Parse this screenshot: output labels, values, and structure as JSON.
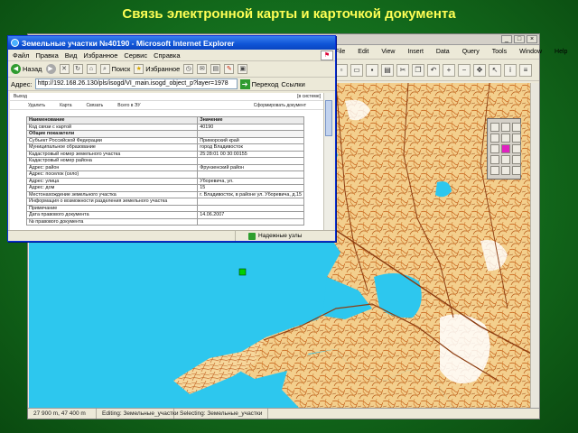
{
  "slide": {
    "title": "Связь электронной карты и карточкой документа"
  },
  "gis": {
    "menu": [
      "File",
      "Edit",
      "View",
      "Insert",
      "Data",
      "Query",
      "Tools",
      "Window",
      "Help"
    ],
    "status": {
      "coords": "27 900 m, 47 400 m",
      "editing": "Editing: Земельные_участки",
      "selecting": "Selecting: Земельные_участки"
    }
  },
  "ie": {
    "title": "Земельные участки №40190 - Microsoft Internet Explorer",
    "menu": [
      "Файл",
      "Правка",
      "Вид",
      "Избранное",
      "Сервис",
      "Справка"
    ],
    "toolbar": {
      "back": "Назад",
      "search": "Поиск",
      "favorites": "Избранное"
    },
    "address": {
      "label": "Адрес:",
      "url": "http://192.168.26.130/pls/isogd/VI_main.isogd_object_p?layer=1978",
      "go": "Переход",
      "links": "Ссылки"
    },
    "status_zone": "Надежные узлы"
  },
  "card": {
    "menu_left": "Выход",
    "menu_right": "[в системе]",
    "actions": [
      "Удалить",
      "Карта",
      "Связать",
      "Всего в ЭУ"
    ],
    "actions_right": "Сформировать документ",
    "header": [
      "Наименование",
      "Значение"
    ],
    "rows": [
      {
        "name": "Код связи с картой",
        "value": "40190",
        "kind": "row"
      },
      {
        "name": "Общие показатели",
        "value": "",
        "kind": "section"
      },
      {
        "name": "Субъект Российской Федерации",
        "value": "Приморский край",
        "kind": "row"
      },
      {
        "name": "Муниципальное образование",
        "value": "город Владивосток",
        "kind": "row"
      },
      {
        "name": "Кадастровый номер земельного участка",
        "value": "25:28:01 00 30:00155",
        "kind": "row"
      },
      {
        "name": "Кадастровый номер района",
        "value": "",
        "kind": "row"
      },
      {
        "name": "Адрес: район",
        "value": "Фрунзенский район",
        "kind": "row"
      },
      {
        "name": "Адрес: поселок (село)",
        "value": "",
        "kind": "row"
      },
      {
        "name": "Адрес: улица",
        "value": "Уборевича, ул.",
        "kind": "row"
      },
      {
        "name": "Адрес: дом",
        "value": "15",
        "kind": "row"
      },
      {
        "name": "Местонахождение земельного участка",
        "value": "г. Владивосток, в районе ул. Уборевича, д.15",
        "kind": "row"
      },
      {
        "name": "Информация о возможности разделения земельного участка",
        "value": "",
        "kind": "row"
      },
      {
        "name": "Примечание",
        "value": "",
        "kind": "row"
      },
      {
        "name": "Дата правового документа",
        "value": "14.06.2007",
        "kind": "row"
      },
      {
        "name": "№ правового документа",
        "value": "",
        "kind": "row"
      }
    ]
  },
  "colors": {
    "background": "#136b1c",
    "title_text": "#ffff55",
    "sea": "#2dc7ee",
    "land": "#f3cf8d",
    "roads": "#c8661e",
    "ie_titlebar": "#0f54d6"
  }
}
